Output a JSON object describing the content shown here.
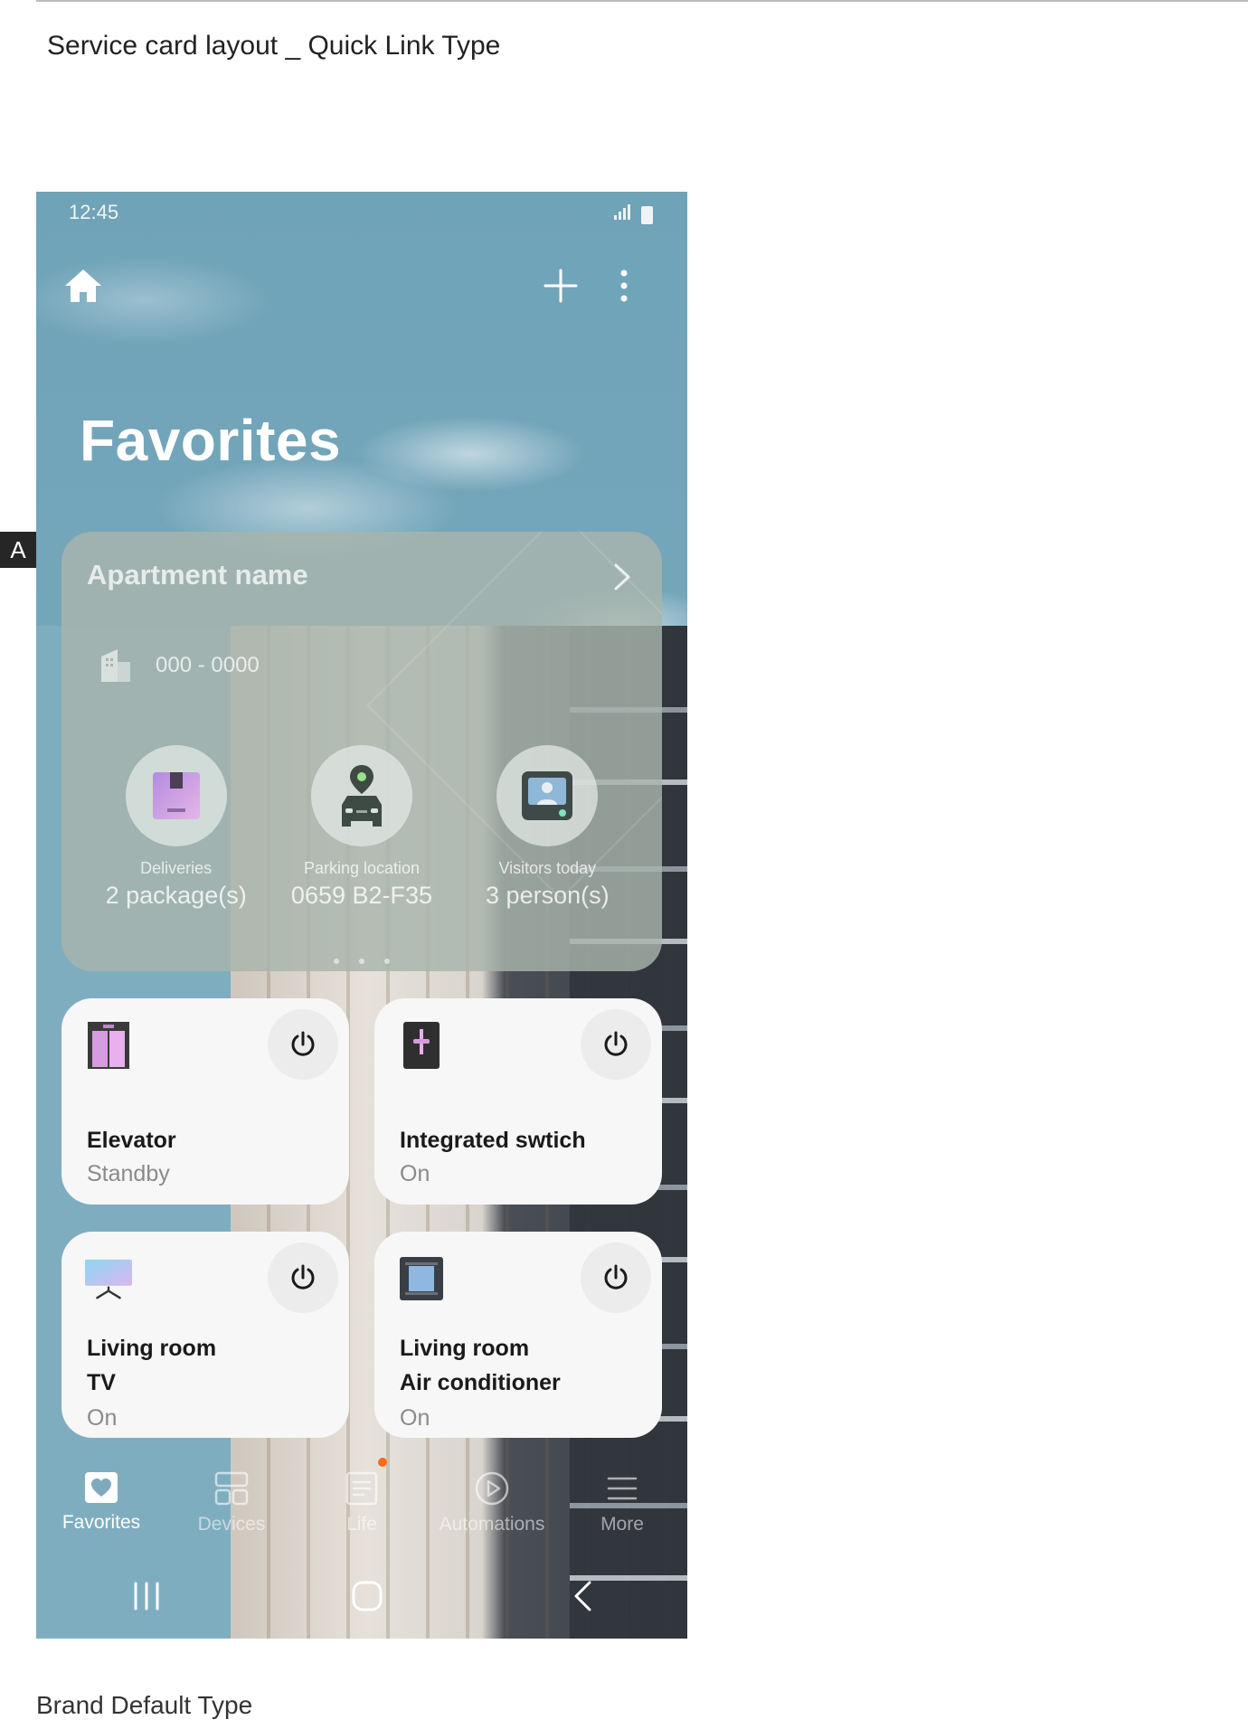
{
  "document": {
    "heading": "Service card layout _ Quick Link Type",
    "section_marker": "A",
    "footer": "Brand Default Type"
  },
  "status_bar": {
    "time": "12:45",
    "icons": [
      "signal-icon",
      "battery-icon"
    ]
  },
  "toolbar": {
    "home_icon": "home-icon",
    "add_icon": "plus-icon",
    "more_icon": "more-vertical-icon"
  },
  "page": {
    "title": "Favorites"
  },
  "service_card": {
    "title": "Apartment name",
    "phone": "000 - 0000",
    "quick_links": [
      {
        "label": "Deliveries",
        "value": "2 package(s)",
        "icon": "package-icon"
      },
      {
        "label": "Parking location",
        "value": "0659 B2-F35",
        "icon": "car-location-icon"
      },
      {
        "label": "Visitors today",
        "value": "3 person(s)",
        "icon": "intercom-icon"
      }
    ],
    "page_indicator": {
      "count": 3,
      "active": 1
    }
  },
  "devices": [
    {
      "name": "Elevator",
      "status": "Standby",
      "icon": "elevator-icon"
    },
    {
      "name": "Integrated swtich",
      "status": "On",
      "icon": "switch-icon"
    },
    {
      "name_line1": "Living room",
      "name_line2": "TV",
      "status": "On",
      "icon": "tv-icon"
    },
    {
      "name_line1": "Living room",
      "name_line2": "Air conditioner",
      "status": "On",
      "icon": "air-conditioner-icon"
    }
  ],
  "bottom_nav": [
    {
      "label": "Favorites",
      "icon": "heart-icon",
      "active": true
    },
    {
      "label": "Devices",
      "icon": "devices-icon",
      "active": false
    },
    {
      "label": "Life",
      "icon": "life-icon",
      "active": false
    },
    {
      "label": "Automations",
      "icon": "play-icon",
      "active": false
    },
    {
      "label": "More",
      "icon": "menu-icon",
      "active": false
    }
  ],
  "colors": {
    "sky": "#79a9bd",
    "card_overlay": "#a8b4ac",
    "device_card": "#f7f7f7",
    "notification_dot": "#ff6a1a"
  }
}
